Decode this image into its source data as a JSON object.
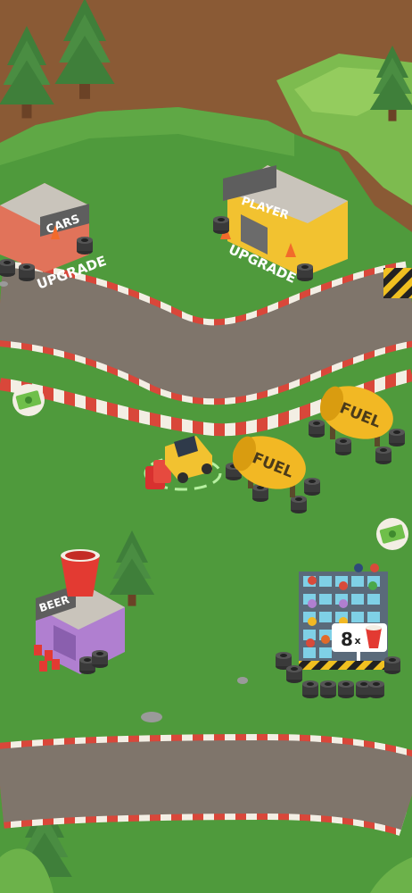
{
  "buildings": {
    "cars": {
      "sign": "CARS",
      "upgrade_label": "UPGRADE"
    },
    "player": {
      "sign": "PLAYER",
      "upgrade_label": "UPGRADE"
    },
    "beer": {
      "sign": "BEER"
    }
  },
  "fuel_tanks": [
    {
      "label": "FUEL"
    },
    {
      "label": "FUEL"
    }
  ],
  "stand": {
    "cup_count": "8",
    "multiplier": "x"
  },
  "pickups": [
    {
      "icon": "cash-icon"
    },
    {
      "icon": "cash-icon"
    }
  ],
  "colors": {
    "grass": "#4f9a3c",
    "track": "#7f756b",
    "curb_red": "#d9473a",
    "curb_white": "#f3eee4",
    "cliff": "#8a5a35",
    "fuel_tank": "#f2b824"
  }
}
